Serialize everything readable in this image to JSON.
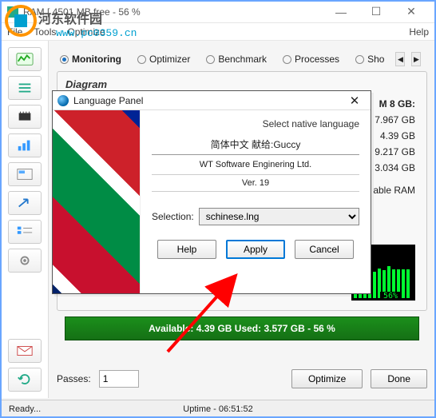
{
  "window": {
    "title": "RAM [ 4501 MB free - 56 %",
    "min": "—",
    "max": "☐",
    "close": "✕"
  },
  "menu": {
    "file": "File",
    "tools": "Tools",
    "optimize": "Optimize",
    "help": "Help"
  },
  "watermark": {
    "text": "河东软件园",
    "url": "www.pc0359.cn"
  },
  "tabs": {
    "monitoring": "Monitoring",
    "optimizer": "Optimizer",
    "benchmark": "Benchmark",
    "processes": "Processes",
    "shortcut": "Sho"
  },
  "diagram": {
    "title": "Diagram",
    "ram_header": "M 8 GB:",
    "rows": [
      "7.967 GB",
      "4.39 GB",
      "9.217 GB",
      "3.034 GB"
    ],
    "able": "able RAM",
    "pct": "56%"
  },
  "avail": {
    "text": "Available: 4.39 GB   Used: 3.577 GB - 56 %"
  },
  "bottom": {
    "passes_label": "Passes:",
    "passes_value": "1",
    "optimize": "Optimize",
    "done": "Done"
  },
  "status": {
    "ready": "Ready...",
    "uptime": "Uptime - 06:51:52"
  },
  "dialog": {
    "title": "Language Panel",
    "close": "✕",
    "select_native": "Select native language",
    "credit": "简体中文  献给:Guccy",
    "vendor": "WT Software Enginering Ltd.",
    "version": "Ver. 19",
    "selection_label": "Selection:",
    "selection_value": "schinese.lng",
    "help": "Help",
    "apply": "Apply",
    "cancel": "Cancel"
  }
}
